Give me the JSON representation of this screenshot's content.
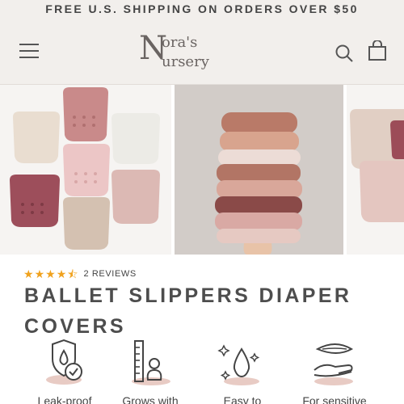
{
  "announcement": {
    "text": "FREE U.S. SHIPPING ON ORDERS OVER $50"
  },
  "header": {
    "logo": {
      "line1_initial": "N",
      "line1_rest": "ora's",
      "line2_rest": "ursery"
    }
  },
  "product": {
    "rating": 4.5,
    "reviews_label": "2 REVIEWS",
    "title": "BALLET SLIPPERS DIAPER COVERS"
  },
  "features": [
    {
      "label": "Leak-proof",
      "icon": "shield-drop-check-icon"
    },
    {
      "label": "Grows with",
      "icon": "baby-height-chart-icon"
    },
    {
      "label": "Easy to",
      "icon": "sparkle-drop-icon"
    },
    {
      "label": "For sensitive",
      "icon": "hand-leaf-icon"
    }
  ],
  "colors": {
    "header_bg": "#f2efec",
    "star": "#f0a21e",
    "text": "#4d4d4d",
    "mauve": "#9a4a57",
    "blush": "#e8cbc4",
    "cream": "#ede2d6"
  }
}
